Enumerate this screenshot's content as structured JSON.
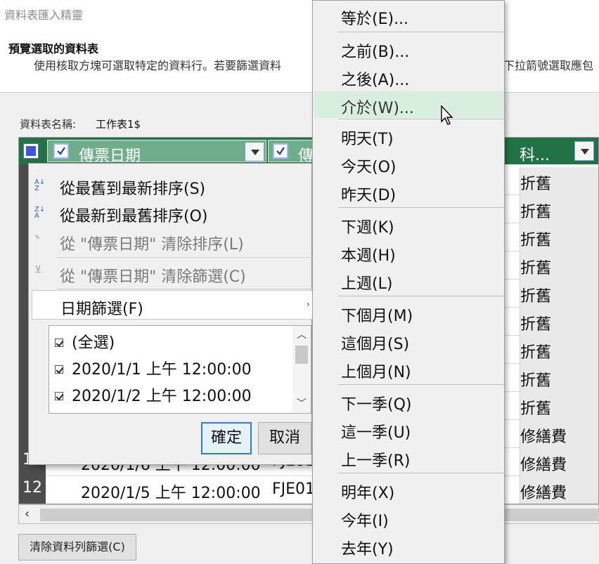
{
  "window": {
    "title": "資料表匯入精靈"
  },
  "preview": {
    "heading": "預覽選取的資料表",
    "description": "使用核取方塊可選取特定的資料行。若要篩選資料",
    "description_tail": "下拉箭號選取應包"
  },
  "sheet": {
    "name_label": "資料表名稱:",
    "name_value": "工作表1$"
  },
  "grid": {
    "col1_header": "傳票日期",
    "col2_header": "傳",
    "col3_header": "科...",
    "rows": [
      {
        "num": "",
        "col3": "折舊"
      },
      {
        "num": "",
        "col3": "折舊"
      },
      {
        "num": "",
        "col3": "折舊"
      },
      {
        "num": "",
        "col3": "折舊"
      },
      {
        "num": "",
        "col3": "折舊"
      },
      {
        "num": "",
        "col3": "折舊"
      },
      {
        "num": "",
        "col3": "折舊"
      },
      {
        "num": "",
        "col3": "折舊"
      },
      {
        "num": "",
        "col3": "折舊"
      },
      {
        "num": "1",
        "col3": "修繕費"
      },
      {
        "num": "11",
        "col1": "2020/1/6 上午 12:00:00",
        "col2": "FJE01",
        "col3": "修繕費"
      },
      {
        "num": "12",
        "col1": "2020/1/5 上午 12:00:00",
        "col2": "FJE01",
        "col3": "修繕費"
      }
    ]
  },
  "filter_panel": {
    "sort_asc": "從最舊到最新排序(S)",
    "sort_desc": "從最新到最舊排序(O)",
    "clear_sort": "從 \"傳票日期\" 清除排序(L)",
    "clear_filter": "從 \"傳票日期\" 清除篩選(C)",
    "date_filter": "日期篩選(F)",
    "list": [
      "(全選)",
      "2020/1/1 上午 12:00:00",
      "2020/1/2 上午 12:00:00"
    ],
    "ok": "確定",
    "cancel": "取消"
  },
  "submenu": {
    "items": [
      "等於(E)...",
      "之前(B)...",
      "之後(A)...",
      "介於(W)...",
      "明天(T)",
      "今天(O)",
      "昨天(D)",
      "下週(K)",
      "本週(H)",
      "上週(L)",
      "下個月(M)",
      "這個月(S)",
      "上個月(N)",
      "下一季(Q)",
      "這一季(U)",
      "上一季(R)",
      "明年(X)",
      "今年(I)",
      "去年(Y)"
    ],
    "highlighted": "介於(W)..."
  },
  "buttons": {
    "clear_row_filter": "清除資料列篩選(C)"
  }
}
